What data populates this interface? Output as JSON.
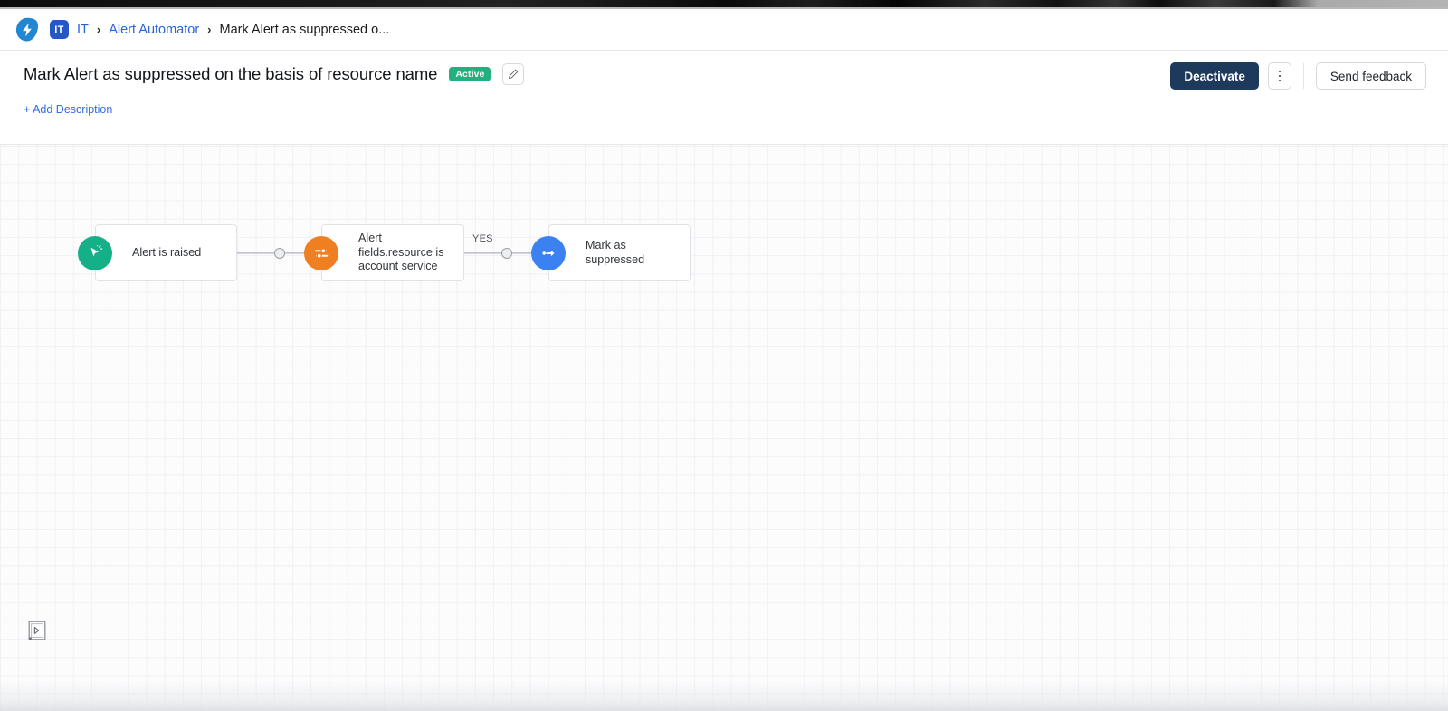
{
  "window": {
    "chrome_strip": "browser-chrome"
  },
  "breadcrumb": {
    "logo_icon": "lightning-bolt-logo",
    "workspace_badge": "IT",
    "items": [
      {
        "label": "IT",
        "type": "link"
      },
      {
        "label": "Alert Automator",
        "type": "link"
      },
      {
        "label": "Mark Alert as suppressed o...",
        "type": "current"
      }
    ],
    "separator": "›"
  },
  "header": {
    "title": "Mark Alert as suppressed on the basis of resource name",
    "status_badge": "Active",
    "status_color": "#22b07d",
    "edit_icon": "pencil-icon",
    "add_description_label": "+ Add Description",
    "actions": {
      "deactivate_label": "Deactivate",
      "deactivate_color": "#1d3a5c",
      "kebab_icon": "more-vertical-icon",
      "feedback_label": "Send feedback"
    }
  },
  "canvas": {
    "panel_toggle_icon": "expand-panel-icon",
    "nodes": [
      {
        "id": "trigger",
        "label": "Alert is raised",
        "icon": "cursor-click-icon",
        "color": "#16b088"
      },
      {
        "id": "condition",
        "label": "Alert fields.resource is account service",
        "icon": "filter-sliders-icon",
        "color": "#f07f22"
      },
      {
        "id": "action",
        "label": "Mark as suppressed",
        "icon": "arrow-forward-icon",
        "color": "#3b82f0"
      }
    ],
    "connectors": [
      {
        "from": "trigger",
        "to": "condition",
        "label": ""
      },
      {
        "from": "condition",
        "to": "action",
        "label": "YES"
      }
    ]
  }
}
